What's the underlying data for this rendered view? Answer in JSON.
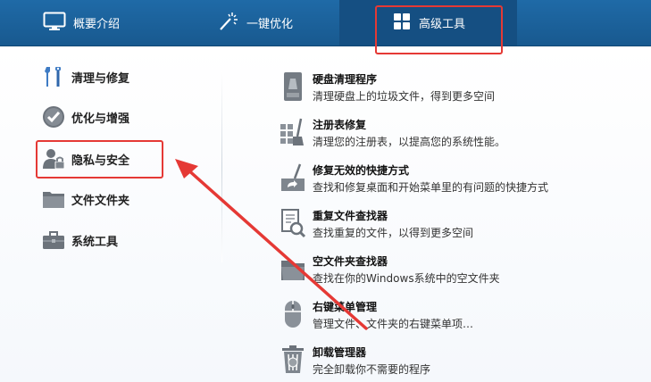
{
  "tabs": {
    "overview": "概要介绍",
    "optimize": "一键优化",
    "advanced": "高级工具"
  },
  "nav": {
    "items": [
      {
        "label": "清理与修复",
        "icon": "wrench-screwdriver-icon"
      },
      {
        "label": "优化与增强",
        "icon": "checkmark-circle-icon"
      },
      {
        "label": "隐私与安全",
        "icon": "user-lock-icon"
      },
      {
        "label": "文件文件夹",
        "icon": "folder-icon"
      },
      {
        "label": "系统工具",
        "icon": "toolbox-icon"
      }
    ],
    "selected_index": 2
  },
  "tools": [
    {
      "title": "硬盘清理程序",
      "desc": "清理硬盘上的垃圾文件，得到更多空间",
      "icon": "disk-cleaner-icon"
    },
    {
      "title": "注册表修复",
      "desc": "清理您的注册表，以提高您的系统性能。",
      "icon": "registry-broom-icon"
    },
    {
      "title": "修复无效的快捷方式",
      "desc": "查找和修复桌面和开始菜单里的有问题的快捷方式",
      "icon": "shortcut-fix-icon"
    },
    {
      "title": "重复文件查找器",
      "desc": "查找重复的文件，以得到更多空间",
      "icon": "duplicate-search-icon"
    },
    {
      "title": "空文件夹查找器",
      "desc": "查找在你的Windows系统中的空文件夹",
      "icon": "empty-folder-icon"
    },
    {
      "title": "右键菜单管理",
      "desc": "管理文件、文件夹的右键菜单项…",
      "icon": "mouse-icon"
    },
    {
      "title": "卸载管理器",
      "desc": "完全卸载你不需要的程序",
      "icon": "recycle-bin-icon"
    }
  ],
  "colors": {
    "tabbar": "#1f6aa7",
    "annotation": "#e53935"
  }
}
